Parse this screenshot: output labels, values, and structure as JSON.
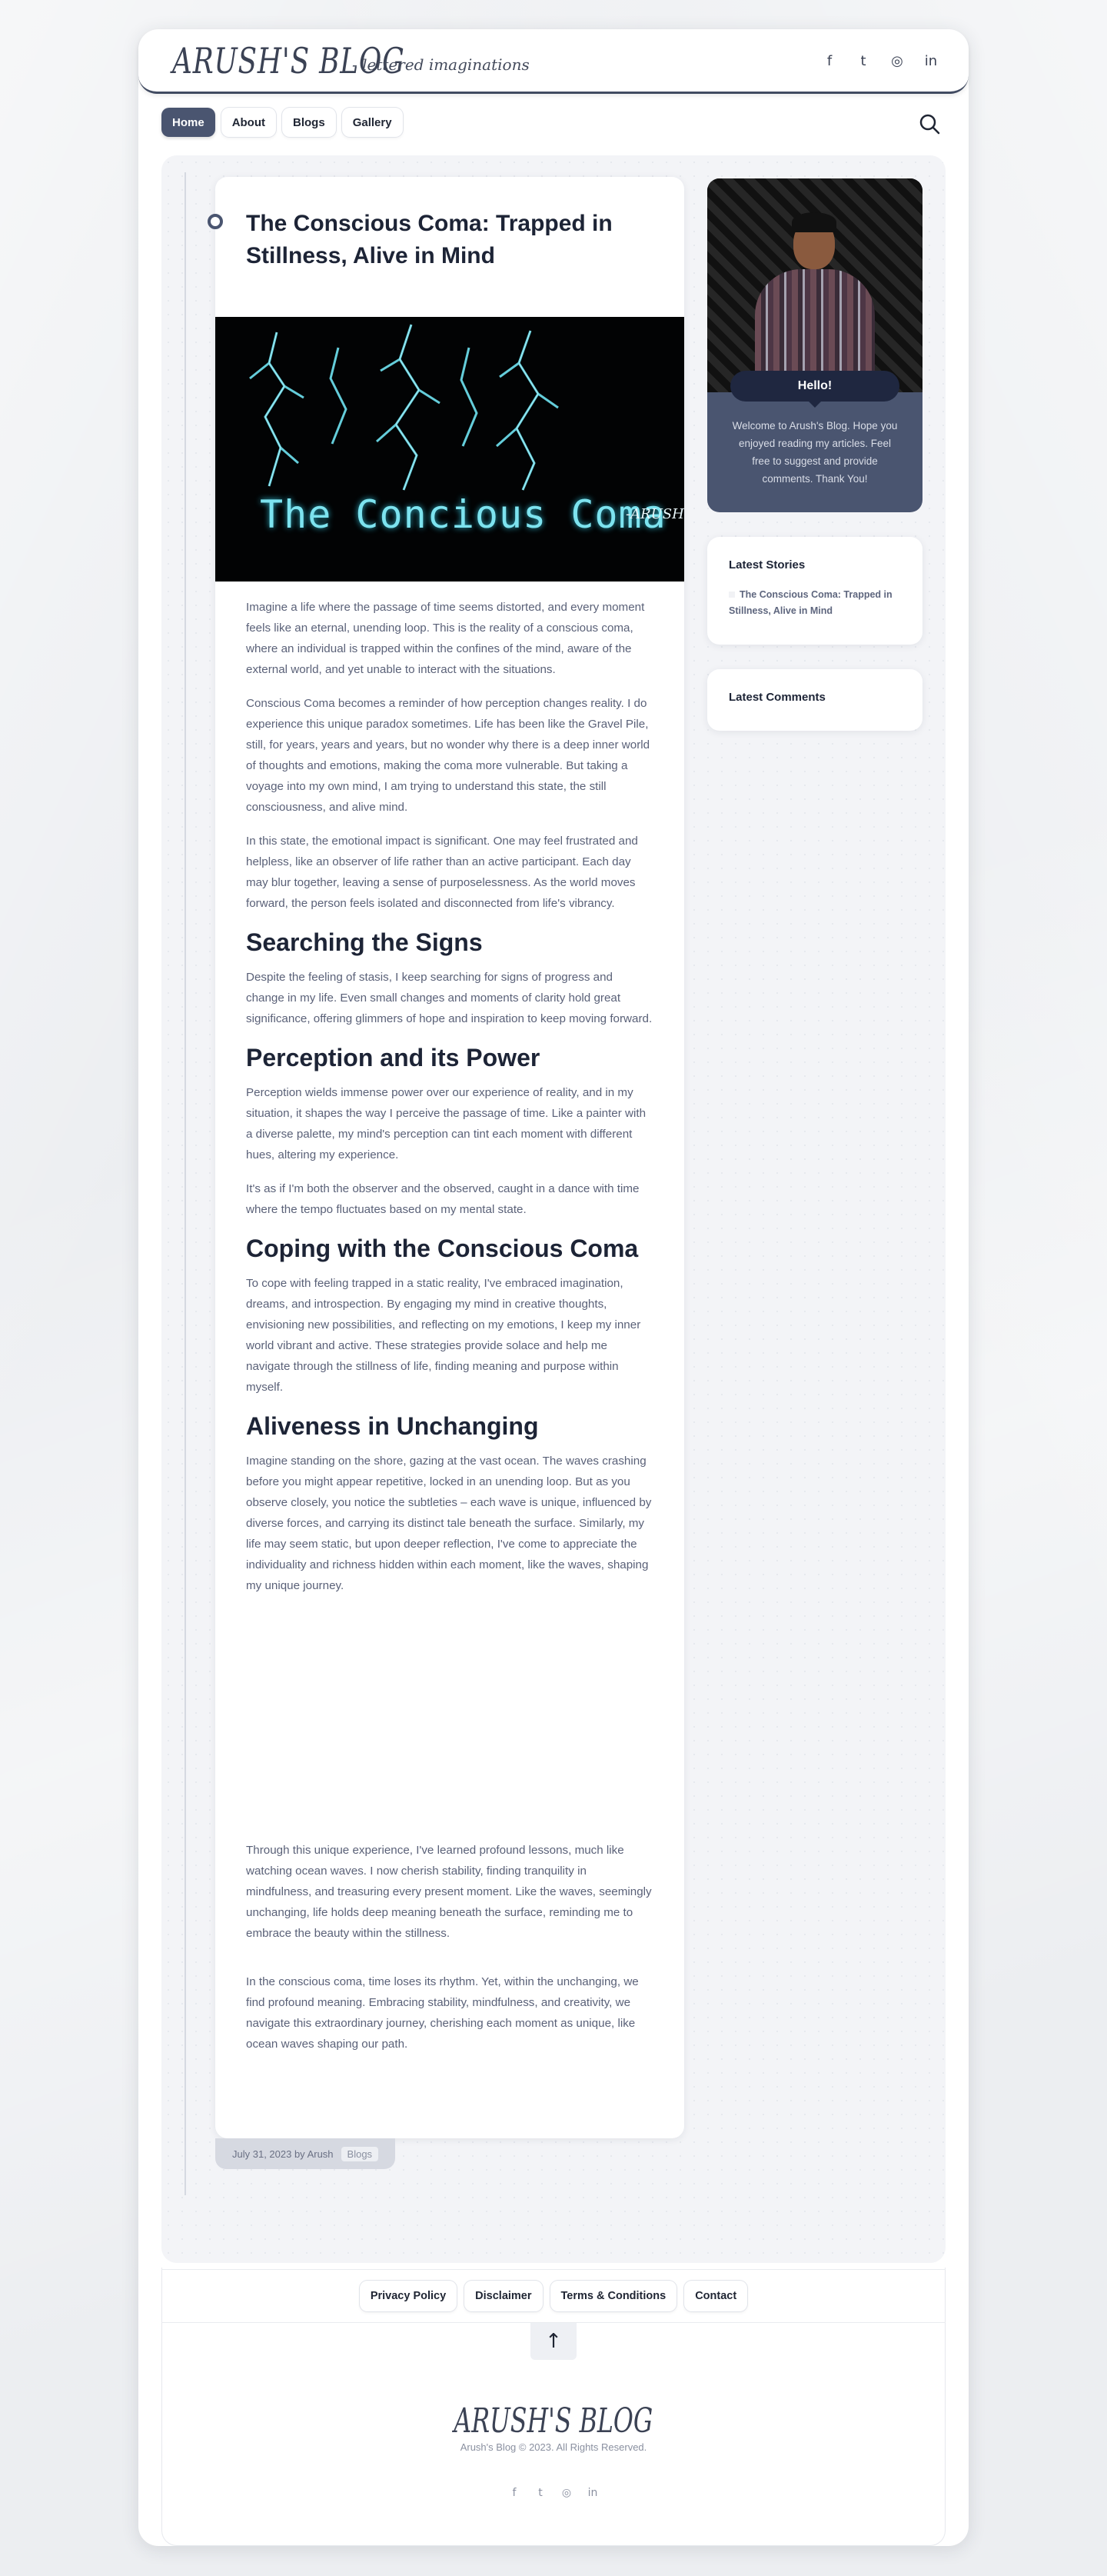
{
  "header": {
    "logo": "ARUSH'S BLOG",
    "tagline": "- lettered imaginations",
    "social_icons": [
      "facebook-icon",
      "twitter-icon",
      "instagram-icon",
      "linkedin-icon"
    ]
  },
  "nav": {
    "items": [
      {
        "label": "Home",
        "active": true
      },
      {
        "label": "About",
        "active": false
      },
      {
        "label": "Blogs",
        "active": false
      },
      {
        "label": "Gallery",
        "active": false
      }
    ],
    "search_icon": "search-icon"
  },
  "article": {
    "title": "The Conscious Coma: Trapped in Stillness, Alive in Mind",
    "hero_text": "The Concious Coma",
    "hero_signature": "-ARUSH",
    "paragraphs_intro": [
      "Imagine a life where the passage of time seems distorted, and every moment feels like an eternal, unending loop. This is the reality of a conscious coma, where an individual is trapped within the confines of the mind, aware of the external world, and yet unable to interact with the situations.",
      "Conscious Coma becomes a reminder of how perception changes reality. I do experience this unique paradox sometimes. Life has been like the Gravel Pile, still, for years, years and years, but no wonder why there is a deep inner world of thoughts and emotions, making the coma more vulnerable. But taking a voyage into my own mind, I am trying to understand this state, the still consciousness, and alive mind.",
      "In this state, the emotional impact is significant. One may feel frustrated and helpless, like an observer of life rather than an active participant. Each day may blur together, leaving a sense of purposelessness. As the world moves forward, the person feels isolated and disconnected from life's vibrancy."
    ],
    "h_searching": "Searching the Signs",
    "p_searching": "Despite the feeling of stasis, I keep searching for signs of progress and change in my life. Even small changes and moments of clarity hold great significance, offering glimmers of hope and inspiration to keep moving forward.",
    "h_perception": "Perception and its Power",
    "p_perception_1": "Perception wields immense power over our experience of reality, and in my situation, it shapes the way I perceive the passage of time. Like a painter with a diverse palette, my mind's perception can tint each moment with different hues, altering my experience.",
    "p_perception_2": "It's as if I'm both the observer and the observed, caught in a dance with time where the tempo fluctuates based on my mental state.",
    "h_coping": "Coping with the Conscious Coma",
    "p_coping": "To cope with feeling trapped in a static reality, I've embraced imagination, dreams, and introspection. By engaging my mind in creative thoughts, envisioning new possibilities, and reflecting on my emotions, I keep my inner world vibrant and active. These strategies provide solace and help me navigate through the stillness of life, finding meaning and purpose within myself.",
    "h_aliveness": "Aliveness in Unchanging",
    "p_aliveness": "Imagine standing on the shore, gazing at the vast ocean. The waves crashing before you might appear repetitive, locked in an unending loop. But as you observe closely, you notice the subtleties – each wave is unique, influenced by diverse forces, and carrying its distinct tale beneath the surface. Similarly, my life may seem static, but upon deeper reflection, I've come to appreciate the individuality and richness hidden within each moment, like the waves, shaping my unique journey.",
    "p_lessons": "Through this unique experience, I've learned profound lessons, much like watching ocean waves. I now cherish stability, finding tranquility in mindfulness, and treasuring every present moment. Like the waves, seemingly unchanging, life holds deep meaning beneath the surface, reminding me to embrace the beauty within the stillness.",
    "p_closing": "In the conscious coma, time loses its rhythm. Yet, within the unchanging, we find profound meaning. Embracing stability, mindfulness, and creativity, we navigate this extraordinary journey, cherishing each moment as unique, like ocean waves shaping our path.",
    "meta": "July 31, 2023 by Arush",
    "category": "Blogs"
  },
  "sidebar": {
    "hello": "Hello!",
    "welcome": "Welcome to Arush's Blog. Hope you enjoyed reading my articles. Feel free to suggest and provide comments. Thank You!",
    "latest_stories_title": "Latest Stories",
    "latest_story": "The Conscious Coma: Trapped in Stillness, Alive in Mind",
    "latest_comments_title": "Latest Comments"
  },
  "footer": {
    "links": [
      "Privacy Policy",
      "Disclaimer",
      "Terms & Conditions",
      "Contact"
    ],
    "logo": "ARUSH'S BLOG",
    "copyright": "Arush's Blog © 2023. All Rights Reserved.",
    "social_icons": [
      "facebook-icon",
      "twitter-icon",
      "instagram-icon",
      "linkedin-icon"
    ]
  }
}
